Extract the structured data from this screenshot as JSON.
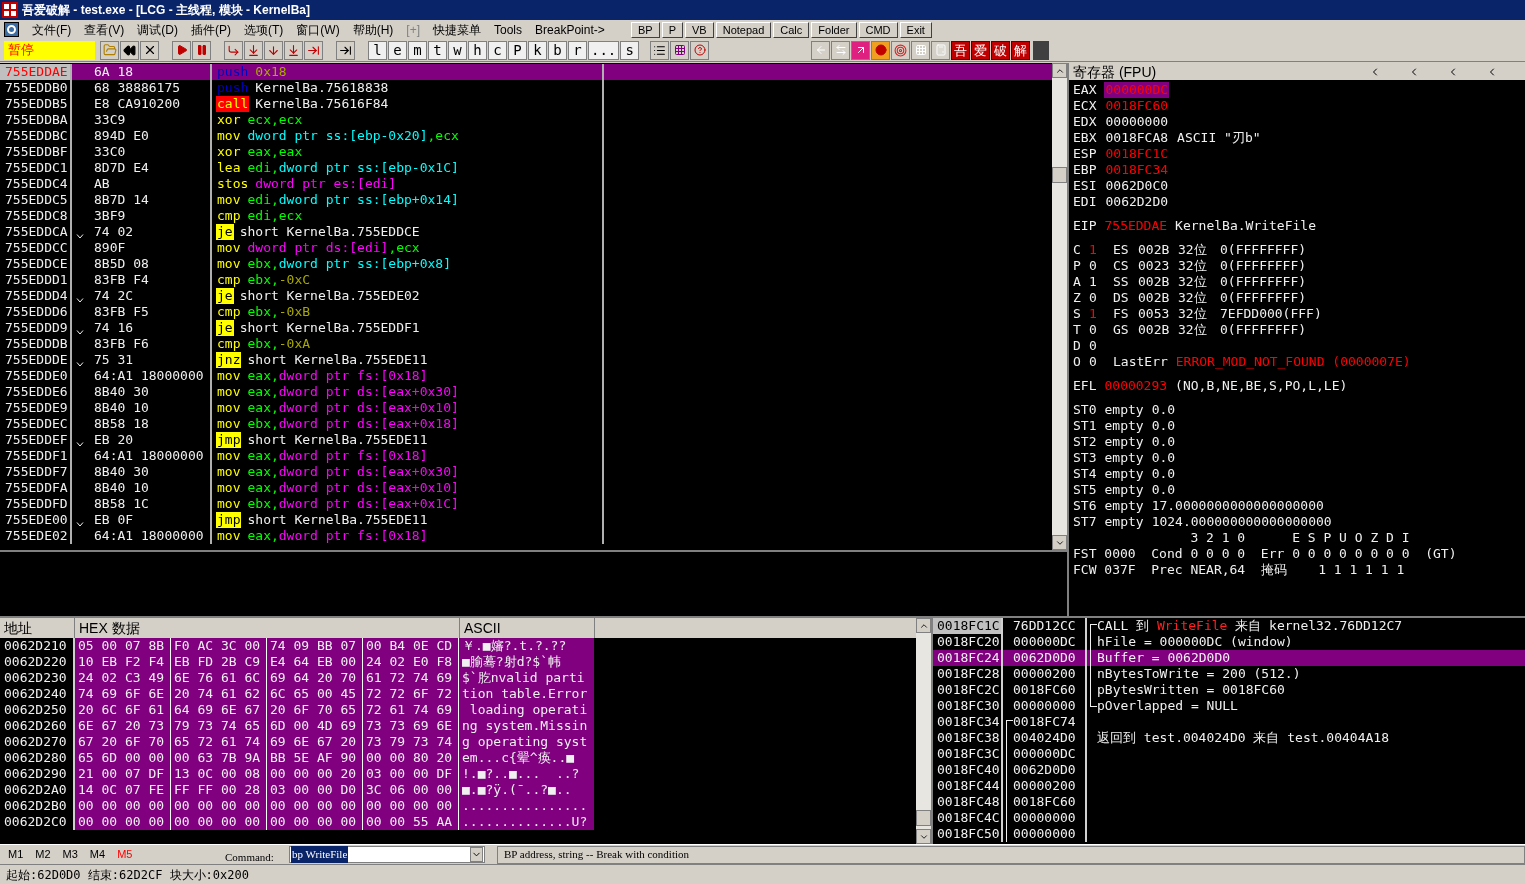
{
  "window": {
    "title": "吾爱破解 - test.exe - [LCG - 主线程, 模块 - KernelBa]"
  },
  "menu": [
    {
      "label": "文件(F)",
      "disabled": false
    },
    {
      "label": "查看(V)",
      "disabled": false
    },
    {
      "label": "调试(D)",
      "disabled": false
    },
    {
      "label": "插件(P)",
      "disabled": false
    },
    {
      "label": "选项(T)",
      "disabled": false
    },
    {
      "label": "窗口(W)",
      "disabled": false
    },
    {
      "label": "帮助(H)",
      "disabled": false
    },
    {
      "label": "[+]",
      "disabled": true
    },
    {
      "label": "快捷菜单",
      "disabled": false
    },
    {
      "label": "Tools",
      "disabled": false
    },
    {
      "label": "BreakPoint->",
      "disabled": false
    }
  ],
  "quick_bar": [
    "BP",
    "P",
    "VB",
    "Notepad",
    "Calc",
    "Folder",
    "CMD",
    "Exit"
  ],
  "toolbar": {
    "status": "暂停",
    "window_buttons": [
      "l",
      "e",
      "m",
      "t",
      "w",
      "h",
      "c",
      "P",
      "k",
      "b",
      "r",
      "...",
      "s"
    ],
    "brand_buttons": [
      "吾",
      "爱",
      "破",
      "解"
    ]
  },
  "disassembly": {
    "rows": [
      {
        "address": "755EDDAE",
        "hex": "6A 18",
        "mnemonic": "push",
        "kind": "push",
        "operands": [
          {
            "text": "0x18",
            "kind": "imm"
          }
        ],
        "eip": true,
        "selected": true
      },
      {
        "address": "755EDDB0",
        "hex": "68 38886175",
        "mnemonic": "push",
        "kind": "push",
        "operands": [
          {
            "text": "KernelBa.75618838",
            "kind": "plain"
          }
        ],
        "eip": false,
        "selected": false
      },
      {
        "address": "755EDDB5",
        "hex": "E8 CA910200",
        "mnemonic": "call",
        "kind": "call",
        "operands": [
          {
            "text": "KernelBa.75616F84",
            "kind": "plain"
          }
        ],
        "eip": false,
        "selected": false
      },
      {
        "address": "755EDDBA",
        "hex": "33C9",
        "mnemonic": "xor",
        "kind": "normal",
        "operands": [
          {
            "text": "ecx,ecx",
            "kind": "reg"
          }
        ],
        "eip": false,
        "selected": false
      },
      {
        "address": "755EDDBC",
        "hex": "894D E0",
        "mnemonic": "mov",
        "kind": "normal",
        "operands": [
          {
            "text": "dword ptr ss:[ebp-0x20]",
            "kind": "mem"
          },
          {
            "text": ",ecx",
            "kind": "reg"
          }
        ],
        "eip": false,
        "selected": false
      },
      {
        "address": "755EDDBF",
        "hex": "33C0",
        "mnemonic": "xor",
        "kind": "normal",
        "operands": [
          {
            "text": "eax,eax",
            "kind": "reg"
          }
        ],
        "eip": false,
        "selected": false
      },
      {
        "address": "755EDDC1",
        "hex": "8D7D E4",
        "mnemonic": "lea",
        "kind": "normal",
        "operands": [
          {
            "text": "edi,",
            "kind": "reg"
          },
          {
            "text": "dword ptr ss:[ebp-0x1C]",
            "kind": "mem"
          }
        ],
        "eip": false,
        "selected": false
      },
      {
        "address": "755EDDC4",
        "hex": "AB",
        "mnemonic": "stos",
        "kind": "normal",
        "operands": [
          {
            "text": "dword ptr es:[edi]",
            "kind": "seg"
          }
        ],
        "eip": false,
        "selected": false
      },
      {
        "address": "755EDDC5",
        "hex": "8B7D 14",
        "mnemonic": "mov",
        "kind": "normal",
        "operands": [
          {
            "text": "edi,",
            "kind": "reg"
          },
          {
            "text": "dword ptr ss:[ebp+0x14]",
            "kind": "mem"
          }
        ],
        "eip": false,
        "selected": false
      },
      {
        "address": "755EDDC8",
        "hex": "3BF9",
        "mnemonic": "cmp",
        "kind": "normal",
        "operands": [
          {
            "text": "edi,ecx",
            "kind": "reg"
          }
        ],
        "eip": false,
        "selected": false
      },
      {
        "address": "755EDDCA",
        "hex": "74 02",
        "mnemonic": "je",
        "kind": "jump",
        "operands": [
          {
            "text": "short KernelBa.755EDDCE",
            "kind": "plain"
          }
        ],
        "eip": false,
        "selected": false
      },
      {
        "address": "755EDDCC",
        "hex": "890F",
        "mnemonic": "mov",
        "kind": "normal",
        "operands": [
          {
            "text": "dword ptr ds:[edi]",
            "kind": "seg"
          },
          {
            "text": ",ecx",
            "kind": "reg"
          }
        ],
        "eip": false,
        "selected": false
      },
      {
        "address": "755EDDCE",
        "hex": "8B5D 08",
        "mnemonic": "mov",
        "kind": "normal",
        "operands": [
          {
            "text": "ebx,",
            "kind": "reg"
          },
          {
            "text": "dword ptr ss:[ebp+0x8]",
            "kind": "mem"
          }
        ],
        "eip": false,
        "selected": false
      },
      {
        "address": "755EDDD1",
        "hex": "83FB F4",
        "mnemonic": "cmp",
        "kind": "normal",
        "operands": [
          {
            "text": "ebx,",
            "kind": "reg"
          },
          {
            "text": "-0xC",
            "kind": "imm"
          }
        ],
        "eip": false,
        "selected": false
      },
      {
        "address": "755EDDD4",
        "hex": "74 2C",
        "mnemonic": "je",
        "kind": "jump",
        "operands": [
          {
            "text": "short KernelBa.755EDE02",
            "kind": "plain"
          }
        ],
        "eip": false,
        "selected": false
      },
      {
        "address": "755EDDD6",
        "hex": "83FB F5",
        "mnemonic": "cmp",
        "kind": "normal",
        "operands": [
          {
            "text": "ebx,",
            "kind": "reg"
          },
          {
            "text": "-0xB",
            "kind": "imm"
          }
        ],
        "eip": false,
        "selected": false
      },
      {
        "address": "755EDDD9",
        "hex": "74 16",
        "mnemonic": "je",
        "kind": "jump",
        "operands": [
          {
            "text": "short KernelBa.755EDDF1",
            "kind": "plain"
          }
        ],
        "eip": false,
        "selected": false
      },
      {
        "address": "755EDDDB",
        "hex": "83FB F6",
        "mnemonic": "cmp",
        "kind": "normal",
        "operands": [
          {
            "text": "ebx,",
            "kind": "reg"
          },
          {
            "text": "-0xA",
            "kind": "imm"
          }
        ],
        "eip": false,
        "selected": false
      },
      {
        "address": "755EDDDE",
        "hex": "75 31",
        "mnemonic": "jnz",
        "kind": "jump",
        "operands": [
          {
            "text": "short KernelBa.755EDE11",
            "kind": "plain"
          }
        ],
        "eip": false,
        "selected": false
      },
      {
        "address": "755EDDE0",
        "hex": "64:A1 18000000",
        "mnemonic": "mov",
        "kind": "normal",
        "operands": [
          {
            "text": "eax,",
            "kind": "reg"
          },
          {
            "text": "dword ptr fs:[0x18]",
            "kind": "seg"
          }
        ],
        "eip": false,
        "selected": false
      },
      {
        "address": "755EDDE6",
        "hex": "8B40 30",
        "mnemonic": "mov",
        "kind": "normal",
        "operands": [
          {
            "text": "eax,",
            "kind": "reg"
          },
          {
            "text": "dword ptr ds:[eax+0x30]",
            "kind": "seg"
          }
        ],
        "eip": false,
        "selected": false
      },
      {
        "address": "755EDDE9",
        "hex": "8B40 10",
        "mnemonic": "mov",
        "kind": "normal",
        "operands": [
          {
            "text": "eax,",
            "kind": "reg"
          },
          {
            "text": "dword ptr ds:[eax+0x10]",
            "kind": "seg"
          }
        ],
        "eip": false,
        "selected": false
      },
      {
        "address": "755EDDEC",
        "hex": "8B58 18",
        "mnemonic": "mov",
        "kind": "normal",
        "operands": [
          {
            "text": "ebx,",
            "kind": "reg"
          },
          {
            "text": "dword ptr ds:[eax+0x18]",
            "kind": "seg"
          }
        ],
        "eip": false,
        "selected": false
      },
      {
        "address": "755EDDEF",
        "hex": "EB 20",
        "mnemonic": "jmp",
        "kind": "jump",
        "operands": [
          {
            "text": "short KernelBa.755EDE11",
            "kind": "plain"
          }
        ],
        "eip": false,
        "selected": false
      },
      {
        "address": "755EDDF1",
        "hex": "64:A1 18000000",
        "mnemonic": "mov",
        "kind": "normal",
        "operands": [
          {
            "text": "eax,",
            "kind": "reg"
          },
          {
            "text": "dword ptr fs:[0x18]",
            "kind": "seg"
          }
        ],
        "eip": false,
        "selected": false
      },
      {
        "address": "755EDDF7",
        "hex": "8B40 30",
        "mnemonic": "mov",
        "kind": "normal",
        "operands": [
          {
            "text": "eax,",
            "kind": "reg"
          },
          {
            "text": "dword ptr ds:[eax+0x30]",
            "kind": "seg"
          }
        ],
        "eip": false,
        "selected": false
      },
      {
        "address": "755EDDFA",
        "hex": "8B40 10",
        "mnemonic": "mov",
        "kind": "normal",
        "operands": [
          {
            "text": "eax,",
            "kind": "reg"
          },
          {
            "text": "dword ptr ds:[eax+0x10]",
            "kind": "seg"
          }
        ],
        "eip": false,
        "selected": false
      },
      {
        "address": "755EDDFD",
        "hex": "8B58 1C",
        "mnemonic": "mov",
        "kind": "normal",
        "operands": [
          {
            "text": "ebx,",
            "kind": "reg"
          },
          {
            "text": "dword ptr ds:[eax+0x1C]",
            "kind": "seg"
          }
        ],
        "eip": false,
        "selected": false
      },
      {
        "address": "755EDE00",
        "hex": "EB 0F",
        "mnemonic": "jmp",
        "kind": "jump",
        "operands": [
          {
            "text": "short KernelBa.755EDE11",
            "kind": "plain"
          }
        ],
        "eip": false,
        "selected": false
      },
      {
        "address": "755EDE02",
        "hex": "64:A1 18000000",
        "mnemonic": "mov",
        "kind": "normal",
        "operands": [
          {
            "text": "eax,",
            "kind": "reg"
          },
          {
            "text": "dword ptr fs:[0x18]",
            "kind": "seg"
          }
        ],
        "eip": false,
        "selected": false
      }
    ]
  },
  "registers_panel": {
    "title": "寄存器 (FPU)",
    "registers": [
      {
        "name": "EAX",
        "value": "000000DC",
        "changed": true,
        "selected": true
      },
      {
        "name": "ECX",
        "value": "0018FC60",
        "changed": true,
        "selected": false
      },
      {
        "name": "EDX",
        "value": "00000000",
        "changed": false,
        "selected": false
      },
      {
        "name": "EBX",
        "value": "0018FCA8",
        "changed": false,
        "selected": false,
        "comment": "ASCII \"刃b\""
      },
      {
        "name": "ESP",
        "value": "0018FC1C",
        "changed": true,
        "selected": false
      },
      {
        "name": "EBP",
        "value": "0018FC34",
        "changed": true,
        "selected": false
      },
      {
        "name": "ESI",
        "value": "0062D0C0",
        "changed": false,
        "selected": false
      },
      {
        "name": "EDI",
        "value": "0062D2D0",
        "changed": false,
        "selected": false
      }
    ],
    "eip": {
      "name": "EIP",
      "value": "755EDDAE",
      "changed": true,
      "comment": "KernelBa.WriteFile"
    },
    "flags": [
      {
        "flag": "C",
        "value": "1",
        "changed": true,
        "segment": {
          "name": "ES",
          "selector": "002B",
          "bits": "32位",
          "limit": "0(FFFFFFFF)"
        }
      },
      {
        "flag": "P",
        "value": "0",
        "changed": false,
        "segment": {
          "name": "CS",
          "selector": "0023",
          "bits": "32位",
          "limit": "0(FFFFFFFF)"
        }
      },
      {
        "flag": "A",
        "value": "1",
        "changed": false,
        "segment": {
          "name": "SS",
          "selector": "002B",
          "bits": "32位",
          "limit": "0(FFFFFFFF)"
        }
      },
      {
        "flag": "Z",
        "value": "0",
        "changed": false,
        "segment": {
          "name": "DS",
          "selector": "002B",
          "bits": "32位",
          "limit": "0(FFFFFFFF)"
        }
      },
      {
        "flag": "S",
        "value": "1",
        "changed": true,
        "segment": {
          "name": "FS",
          "selector": "0053",
          "bits": "32位",
          "limit": "7EFDD000(FFF)"
        }
      },
      {
        "flag": "T",
        "value": "0",
        "changed": false,
        "segment": {
          "name": "GS",
          "selector": "002B",
          "bits": "32位",
          "limit": "0(FFFFFFFF)"
        }
      },
      {
        "flag": "D",
        "value": "0",
        "changed": false
      },
      {
        "flag": "O",
        "value": "0",
        "changed": false,
        "last_error": {
          "label": "LastErr",
          "value": "ERROR_MOD_NOT_FOUND (0000007E)"
        }
      }
    ],
    "efl": {
      "name": "EFL",
      "value": "00000293",
      "changed": true,
      "comment": "(NO,B,NE,BE,S,PO,L,LE)"
    },
    "fpu": [
      {
        "name": "ST0",
        "tag": "empty",
        "value": "0.0"
      },
      {
        "name": "ST1",
        "tag": "empty",
        "value": "0.0"
      },
      {
        "name": "ST2",
        "tag": "empty",
        "value": "0.0"
      },
      {
        "name": "ST3",
        "tag": "empty",
        "value": "0.0"
      },
      {
        "name": "ST4",
        "tag": "empty",
        "value": "0.0"
      },
      {
        "name": "ST5",
        "tag": "empty",
        "value": "0.0"
      },
      {
        "name": "ST6",
        "tag": "empty",
        "value": "17.0000000000000000000"
      },
      {
        "name": "ST7",
        "tag": "empty",
        "value": "1024.000000000000000000"
      }
    ],
    "fpu_header": "               3 2 1 0      E S P U O Z D I",
    "fst": "FST 0000  Cond 0 0 0 0  Err 0 0 0 0 0 0 0 0  (GT)",
    "fcw": "FCW 037F  Prec NEAR,64  掩码    1 1 1 1 1 1"
  },
  "dump": {
    "columns": [
      "地址",
      "HEX 数据",
      "ASCII"
    ],
    "rows": [
      {
        "address": "0062D210",
        "bytes": [
          "05 00 07 8B",
          "F0 AC 3C 00",
          "74 09 BB 07",
          "00 B4 0E CD"
        ],
        "ascii": "￥.■嬸?.t.?.??",
        "selected": true
      },
      {
        "address": "0062D220",
        "bytes": [
          "10 EB F2 F4",
          "EB FD 2B C9",
          "E4 64 EB 00",
          "24 02 E0 F8"
        ],
        "ascii": "■腧蓦?射d?$`帏",
        "selected": true
      },
      {
        "address": "0062D230",
        "bytes": [
          "24 02 C3 49",
          "6E 76 61 6C",
          "69 64 20 70",
          "61 72 74 69"
        ],
        "ascii": "$`肐nvalid parti",
        "selected": true
      },
      {
        "address": "0062D240",
        "bytes": [
          "74 69 6F 6E",
          "20 74 61 62",
          "6C 65 00 45",
          "72 72 6F 72"
        ],
        "ascii": "tion table.Error",
        "selected": true
      },
      {
        "address": "0062D250",
        "bytes": [
          "20 6C 6F 61",
          "64 69 6E 67",
          "20 6F 70 65",
          "72 61 74 69"
        ],
        "ascii": " loading operati",
        "selected": true
      },
      {
        "address": "0062D260",
        "bytes": [
          "6E 67 20 73",
          "79 73 74 65",
          "6D 00 4D 69",
          "73 73 69 6E"
        ],
        "ascii": "ng system.Missin",
        "selected": true
      },
      {
        "address": "0062D270",
        "bytes": [
          "67 20 6F 70",
          "65 72 61 74",
          "69 6E 67 20",
          "73 79 73 74"
        ],
        "ascii": "g operating syst",
        "selected": true
      },
      {
        "address": "0062D280",
        "bytes": [
          "65 6D 00 00",
          "00 63 7B 9A",
          "BB 5E AF 90",
          "00 00 80 20"
        ],
        "ascii": "em...c{翚^痪..■",
        "selected": true
      },
      {
        "address": "0062D290",
        "bytes": [
          "21 00 07 DF",
          "13 0C 00 08",
          "00 00 00 20",
          "03 00 00 DF"
        ],
        "ascii": "!.■?..■...  ..?",
        "selected": true
      },
      {
        "address": "0062D2A0",
        "bytes": [
          "14 0C 07 FE",
          "FF FF 00 28",
          "03 00 00 D0",
          "3C 06 00 00"
        ],
        "ascii": "■.■?ÿ.(¯..?■..",
        "selected": true
      },
      {
        "address": "0062D2B0",
        "bytes": [
          "00 00 00 00",
          "00 00 00 00",
          "00 00 00 00",
          "00 00 00 00"
        ],
        "ascii": "................",
        "selected": true
      },
      {
        "address": "0062D2C0",
        "bytes": [
          "00 00 00 00",
          "00 00 00 00",
          "00 00 00 00",
          "00 00 55 AA"
        ],
        "ascii": "..............U?",
        "selected": true
      }
    ]
  },
  "stack": {
    "rows": [
      {
        "address": "0018FC1C",
        "value": "76DD12CC",
        "esp": true,
        "selected": false,
        "kind": "call_start",
        "comment": [
          {
            "text": "CALL 到 ",
            "kind": "plain"
          },
          {
            "text": "WriteFile",
            "kind": "api"
          },
          {
            "text": " 来自 kernel32.76DD12C7",
            "kind": "plain"
          }
        ]
      },
      {
        "address": "0018FC20",
        "value": "000000DC",
        "esp": false,
        "selected": false,
        "kind": "call_middle",
        "comment": [
          {
            "text": "hFile = 000000DC (window)",
            "kind": "plain"
          }
        ]
      },
      {
        "address": "0018FC24",
        "value": "0062D0D0",
        "esp": false,
        "selected": true,
        "kind": "call_middle",
        "comment": [
          {
            "text": "Buffer = 0062D0D0",
            "kind": "plain"
          }
        ]
      },
      {
        "address": "0018FC28",
        "value": "00000200",
        "esp": false,
        "selected": false,
        "kind": "call_middle",
        "comment": [
          {
            "text": "nBytesToWrite = 200 (512.)",
            "kind": "plain"
          }
        ]
      },
      {
        "address": "0018FC2C",
        "value": "0018FC60",
        "esp": false,
        "selected": false,
        "kind": "call_middle",
        "comment": [
          {
            "text": "pBytesWritten = 0018FC60",
            "kind": "plain"
          }
        ]
      },
      {
        "address": "0018FC30",
        "value": "00000000",
        "esp": false,
        "selected": false,
        "kind": "call_end",
        "comment": [
          {
            "text": "pOverlapped = NULL",
            "kind": "plain"
          }
        ]
      },
      {
        "address": "0018FC34",
        "value": "0018FC74",
        "esp": false,
        "selected": false,
        "kind": "frame_start"
      },
      {
        "address": "0018FC38",
        "value": "004024D0",
        "esp": false,
        "selected": false,
        "kind": "frame_middle",
        "comment": [
          {
            "text": "返回到 test.004024D0 来自 test.00404A18",
            "kind": "plain"
          }
        ]
      },
      {
        "address": "0018FC3C",
        "value": "000000DC",
        "esp": false,
        "selected": false,
        "kind": "frame_middle"
      },
      {
        "address": "0018FC40",
        "value": "0062D0D0",
        "esp": false,
        "selected": false,
        "kind": "frame_middle"
      },
      {
        "address": "0018FC44",
        "value": "00000200",
        "esp": false,
        "selected": false,
        "kind": "frame_middle"
      },
      {
        "address": "0018FC48",
        "value": "0018FC60",
        "esp": false,
        "selected": false,
        "kind": "frame_middle"
      },
      {
        "address": "0018FC4C",
        "value": "00000000",
        "esp": false,
        "selected": false,
        "kind": "frame_middle"
      },
      {
        "address": "0018FC50",
        "value": "00000000",
        "esp": false,
        "selected": false,
        "kind": "frame_middle"
      }
    ]
  },
  "command_bar": {
    "marks": [
      {
        "label": "M1",
        "highlighted": false
      },
      {
        "label": "M2",
        "highlighted": false
      },
      {
        "label": "M3",
        "highlighted": false
      },
      {
        "label": "M4",
        "highlighted": false
      },
      {
        "label": "M5",
        "highlighted": true
      }
    ],
    "label": "Command:",
    "value": "bp WriteFile",
    "value_selected": true,
    "help": "BP address, string -- Break with condition"
  },
  "status_bar": "起始:62D0D0 结束:62D2CF 块大小:0x200"
}
